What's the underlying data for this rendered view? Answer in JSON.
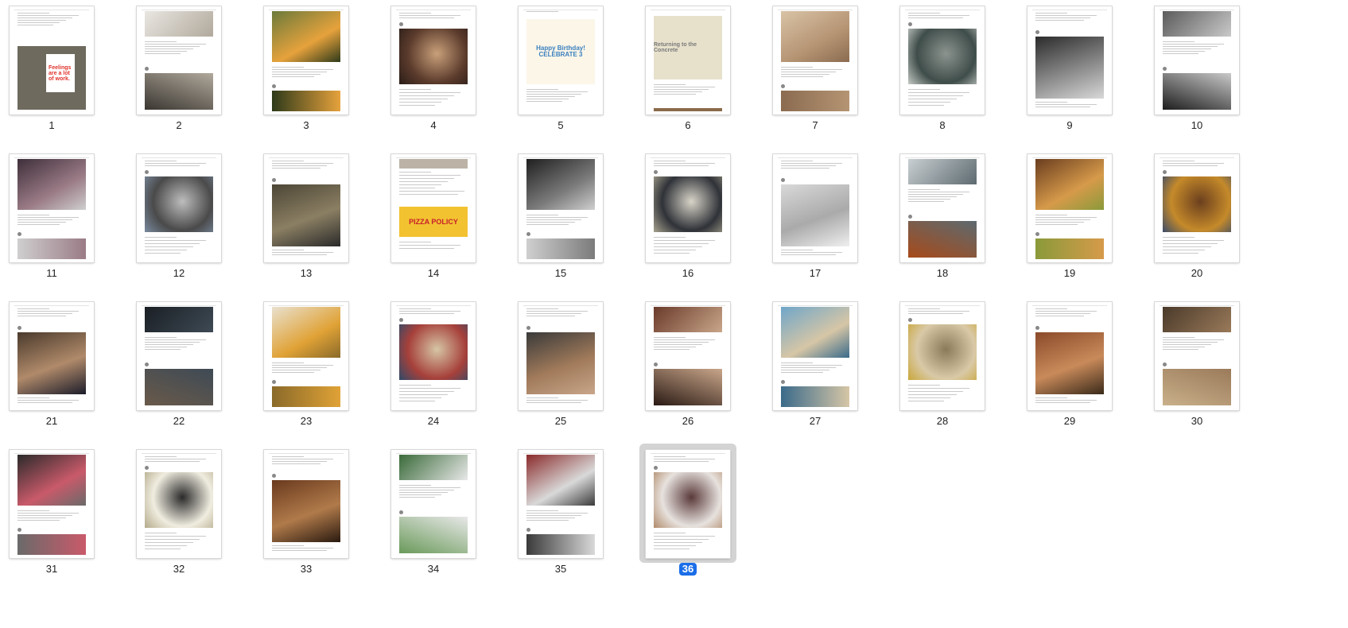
{
  "viewer": {
    "mode": "Contact sheet / page thumbnails",
    "selected_page": "36"
  },
  "pages": [
    {
      "label": "1",
      "art": "feelings",
      "art_text": "Feelings are a lot of work."
    },
    {
      "label": "2",
      "art": "photo",
      "colors": [
        "#e9e6e1",
        "#b1a99c",
        "#3a3631"
      ]
    },
    {
      "label": "3",
      "art": "photo",
      "colors": [
        "#6b7a3c",
        "#e6a23c",
        "#2e3a1a"
      ]
    },
    {
      "label": "4",
      "art": "photo",
      "colors": [
        "#5b3b2c",
        "#c9a07a",
        "#2a1d18"
      ]
    },
    {
      "label": "5",
      "art": "birthday",
      "art_text": "Happy Birthday! CELEBRATE 3"
    },
    {
      "label": "6",
      "art": "beige",
      "art_text": "Returning to the Concrete"
    },
    {
      "label": "7",
      "art": "photo",
      "colors": [
        "#d9c3a6",
        "#b59473",
        "#8b6b50"
      ]
    },
    {
      "label": "8",
      "art": "photo",
      "colors": [
        "#3f4d4a",
        "#8c948f",
        "#c6cbc6"
      ]
    },
    {
      "label": "9",
      "art": "photo",
      "colors": [
        "#2b2b2b",
        "#8a8a8a",
        "#d8d8d8"
      ]
    },
    {
      "label": "10",
      "art": "photo",
      "colors": [
        "#5b5b5b",
        "#c9c9c9",
        "#1d1d1d"
      ]
    },
    {
      "label": "11",
      "art": "photo",
      "colors": [
        "#3e2f3a",
        "#9a7b86",
        "#cfcfcf"
      ]
    },
    {
      "label": "12",
      "art": "photo",
      "colors": [
        "#4a4a4a",
        "#bdbdbd",
        "#7a8ba0"
      ]
    },
    {
      "label": "13",
      "art": "photo",
      "colors": [
        "#4c4636",
        "#8b7f63",
        "#2a2a2a"
      ]
    },
    {
      "label": "14",
      "art": "pizza",
      "art_text": "PIZZA POLICY"
    },
    {
      "label": "15",
      "art": "photo",
      "colors": [
        "#1f1f1f",
        "#7b7b7b",
        "#cfcfcf"
      ]
    },
    {
      "label": "16",
      "art": "photo",
      "colors": [
        "#2f3238",
        "#d8d4c8",
        "#a8a38f"
      ]
    },
    {
      "label": "17",
      "art": "photo",
      "colors": [
        "#d9d9d9",
        "#aaaaaa",
        "#efefef"
      ]
    },
    {
      "label": "18",
      "art": "photo",
      "colors": [
        "#c9cfd2",
        "#5d6a6f",
        "#a74a1a"
      ]
    },
    {
      "label": "19",
      "art": "photo",
      "colors": [
        "#6a3d1f",
        "#d69a4a",
        "#8a9a3a"
      ]
    },
    {
      "label": "20",
      "art": "photo",
      "colors": [
        "#c58a2a",
        "#6b3f1e",
        "#3a4a6a"
      ]
    },
    {
      "label": "21",
      "art": "photo",
      "colors": [
        "#4a3a2c",
        "#b08a6a",
        "#1c1c2a"
      ]
    },
    {
      "label": "22",
      "art": "photo",
      "colors": [
        "#1a1f24",
        "#3e4a55",
        "#6a5a4a"
      ]
    },
    {
      "label": "23",
      "art": "photo",
      "colors": [
        "#e9e1cf",
        "#e0a236",
        "#8a6a2a"
      ]
    },
    {
      "label": "24",
      "art": "photo",
      "colors": [
        "#a6403a",
        "#d6c6a6",
        "#2e4a6a"
      ]
    },
    {
      "label": "25",
      "art": "photo",
      "colors": [
        "#3a3a3a",
        "#a07a5a",
        "#c9a68a"
      ]
    },
    {
      "label": "26",
      "art": "photo",
      "colors": [
        "#6a3a2a",
        "#c9a68a",
        "#2a1a14"
      ]
    },
    {
      "label": "27",
      "art": "photo",
      "colors": [
        "#6fa6c9",
        "#d6c6a6",
        "#3a6a8a"
      ]
    },
    {
      "label": "28",
      "art": "photo",
      "colors": [
        "#d9c9a6",
        "#8a7a5a",
        "#c9a63a"
      ]
    },
    {
      "label": "29",
      "art": "photo",
      "colors": [
        "#8a4a2a",
        "#c98a5a",
        "#3a2a1a"
      ]
    },
    {
      "label": "30",
      "art": "photo",
      "colors": [
        "#4a3a2a",
        "#9a7a5a",
        "#c9b08a"
      ]
    },
    {
      "label": "31",
      "art": "photo",
      "colors": [
        "#2a2a2a",
        "#c95a6a",
        "#6a6a6a"
      ]
    },
    {
      "label": "32",
      "art": "photo",
      "colors": [
        "#f0ede0",
        "#2a2a2a",
        "#b3a98a"
      ]
    },
    {
      "label": "33",
      "art": "photo",
      "colors": [
        "#6a3a1e",
        "#b07a4a",
        "#2a1a10"
      ]
    },
    {
      "label": "34",
      "art": "photo",
      "colors": [
        "#3a6a3a",
        "#e8e8e8",
        "#6a9a5a"
      ]
    },
    {
      "label": "35",
      "art": "photo",
      "colors": [
        "#8a2a2a",
        "#d9d9d9",
        "#3a3a3a"
      ]
    },
    {
      "label": "36",
      "art": "photo",
      "colors": [
        "#e7e2de",
        "#5a3a3a",
        "#b08a6a"
      ]
    }
  ],
  "colors": {
    "selection_badge": "#1b6ee8",
    "selection_halo": "#d4d4d4",
    "page_border": "#d8d8d8"
  }
}
